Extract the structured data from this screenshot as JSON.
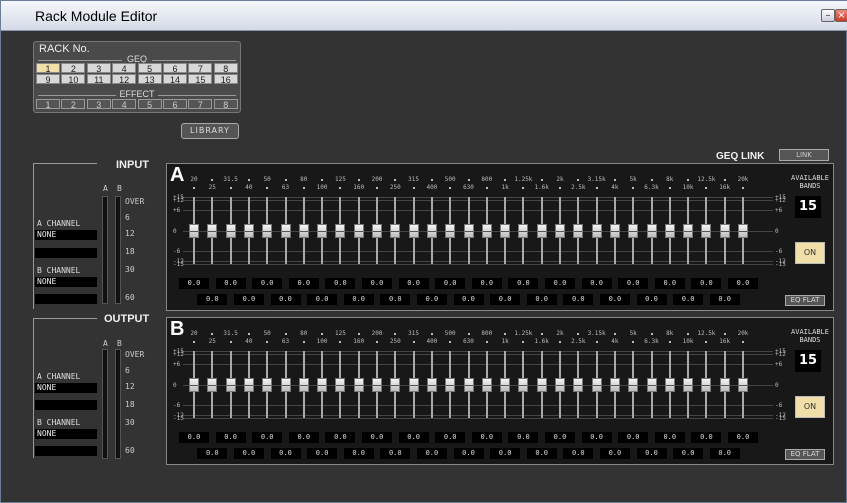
{
  "window": {
    "title": "Rack Module Editor",
    "min_icon": "minimize-icon",
    "close_icon": "close-icon"
  },
  "rack": {
    "title": "RACK No.",
    "geq_label": "GEQ",
    "effect_label": "EFFECT",
    "geq_row1": [
      "1",
      "2",
      "3",
      "4",
      "5",
      "6",
      "7",
      "8"
    ],
    "geq_row2": [
      "9",
      "10",
      "11",
      "12",
      "13",
      "14",
      "15",
      "16"
    ],
    "effect_row": [
      "1",
      "2",
      "3",
      "4",
      "5",
      "6",
      "7",
      "8"
    ],
    "selected": "1"
  },
  "library_label": "LIBRARY",
  "geq_link": {
    "label": "GEQ LINK",
    "button": "LINK"
  },
  "input": {
    "label": "INPUT",
    "a_channel": "A CHANNEL",
    "a_value": "NONE",
    "b_channel": "B CHANNEL",
    "b_value": "NONE"
  },
  "output": {
    "label": "OUTPUT",
    "a_channel": "A CHANNEL",
    "a_value": "NONE",
    "b_channel": "B CHANNEL",
    "b_value": "NONE"
  },
  "meter": {
    "a": "A",
    "b": "B",
    "scale": [
      "OVER",
      "6",
      "12",
      "18",
      "30",
      "60"
    ]
  },
  "freqs_top": [
    "20",
    "31.5",
    "50",
    "80",
    "125",
    "200",
    "315",
    "500",
    "800",
    "1.25k",
    "2k",
    "3.15k",
    "5k",
    "8k",
    "12.5k",
    "20k"
  ],
  "freqs_bottom": [
    "25",
    "40",
    "63",
    "100",
    "160",
    "250",
    "400",
    "630",
    "1k",
    "1.6k",
    "2.5k",
    "4k",
    "6.3k",
    "10k",
    "16k"
  ],
  "db_left": [
    "+15",
    "+12",
    "+6",
    "0",
    "-6",
    "-12",
    "-15"
  ],
  "db_right": [
    "+15",
    "+12",
    "+6",
    "0",
    "-6",
    "-12",
    "-15"
  ],
  "geqs": [
    {
      "letter": "A",
      "available_label": "AVAILABLE BANDS",
      "available": "15",
      "on": "ON",
      "flat": "EQ FLAT",
      "values_top": [
        "0.0",
        "0.0",
        "0.0",
        "0.0",
        "0.0",
        "0.0",
        "0.0",
        "0.0",
        "0.0",
        "0.0",
        "0.0",
        "0.0",
        "0.0",
        "0.0",
        "0.0",
        "0.0"
      ],
      "values_bottom": [
        "0.0",
        "0.0",
        "0.0",
        "0.0",
        "0.0",
        "0.0",
        "0.0",
        "0.0",
        "0.0",
        "0.0",
        "0.0",
        "0.0",
        "0.0",
        "0.0",
        "0.0"
      ]
    },
    {
      "letter": "B",
      "available_label": "AVAILABLE BANDS",
      "available": "15",
      "on": "ON",
      "flat": "EQ FLAT",
      "values_top": [
        "0.0",
        "0.0",
        "0.0",
        "0.0",
        "0.0",
        "0.0",
        "0.0",
        "0.0",
        "0.0",
        "0.0",
        "0.0",
        "0.0",
        "0.0",
        "0.0",
        "0.0",
        "0.0"
      ],
      "values_bottom": [
        "0.0",
        "0.0",
        "0.0",
        "0.0",
        "0.0",
        "0.0",
        "0.0",
        "0.0",
        "0.0",
        "0.0",
        "0.0",
        "0.0",
        "0.0",
        "0.0",
        "0.0"
      ]
    }
  ],
  "band_gains_db": [
    0,
    0,
    0,
    0,
    0,
    0,
    0,
    0,
    0,
    0,
    0,
    0,
    0,
    0,
    0,
    0,
    0,
    0,
    0,
    0,
    0,
    0,
    0,
    0,
    0,
    0,
    0,
    0,
    0,
    0,
    0
  ]
}
